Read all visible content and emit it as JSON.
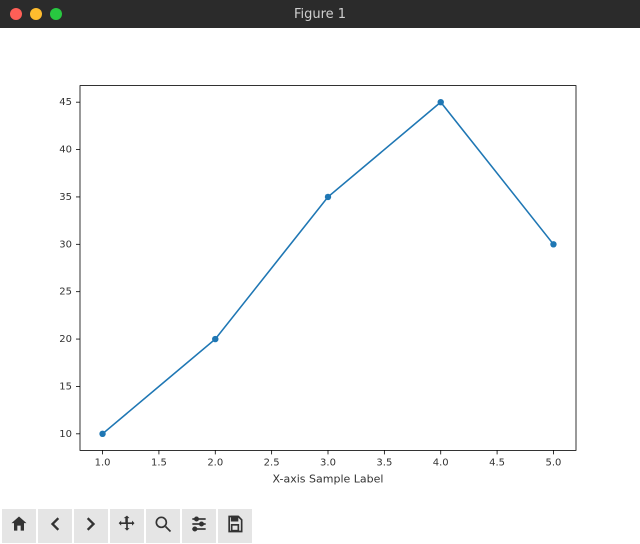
{
  "window": {
    "title": "Figure 1"
  },
  "chart_data": {
    "type": "line",
    "x": [
      1,
      2,
      3,
      4,
      5
    ],
    "y": [
      10,
      20,
      35,
      45,
      30
    ],
    "xticks": [
      1.0,
      1.5,
      2.0,
      2.5,
      3.0,
      3.5,
      4.0,
      4.5,
      5.0
    ],
    "yticks": [
      10,
      15,
      20,
      25,
      30,
      35,
      40,
      45
    ],
    "xtick_labels": [
      "1.0",
      "1.5",
      "2.0",
      "2.5",
      "3.0",
      "3.5",
      "4.0",
      "4.5",
      "5.0"
    ],
    "ytick_labels": [
      "10",
      "15",
      "20",
      "25",
      "30",
      "35",
      "40",
      "45"
    ],
    "xlabel": "X-axis Sample Label",
    "ylabel": "",
    "title": "",
    "xlim": [
      0.8,
      5.2
    ],
    "ylim": [
      8.25,
      46.75
    ],
    "line_color": "#1f77b4",
    "marker": "o"
  },
  "toolbar": {
    "home": "Home",
    "back": "Back",
    "forward": "Forward",
    "pan": "Pan",
    "zoom": "Zoom",
    "subplots": "Configure subplots",
    "save": "Save"
  }
}
